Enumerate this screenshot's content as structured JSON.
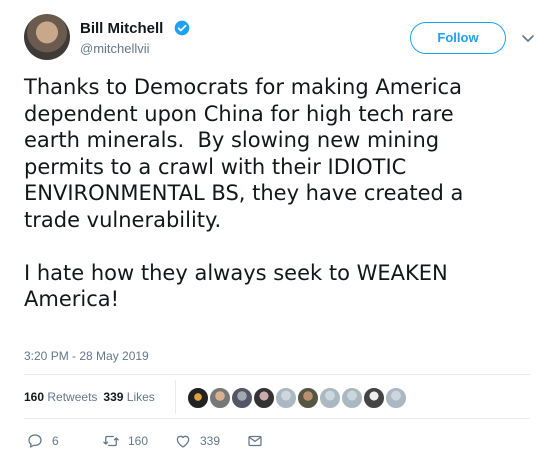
{
  "author": {
    "name": "Bill Mitchell",
    "handle": "@mitchellvii",
    "verified": true
  },
  "follow_label": "Follow",
  "tweet": {
    "text": "Thanks to Democrats for making America\ndependent upon China for high tech rare\nearth minerals.  By slowing new mining\npermits to a crawl with their IDIOTIC\nENVIRONMENTAL BS, they have created a\ntrade vulnerability.\n\nI hate how they always seek to WEAKEN\nAmerica!",
    "timestamp": "3:20 PM - 28 May 2019"
  },
  "stats": {
    "retweets_count": "160",
    "retweets_label": "Retweets",
    "likes_count": "339",
    "likes_label": "Likes"
  },
  "actions": {
    "replies": "6",
    "retweets": "160",
    "likes": "339"
  },
  "colors": {
    "accent": "#1da1f2",
    "secondary_text": "#657786",
    "primary_text": "#14171a",
    "divider": "#e6ecf0"
  },
  "icons": [
    "verified-badge-icon",
    "chevron-down-icon",
    "reply-icon",
    "retweet-icon",
    "like-icon",
    "direct-message-icon"
  ]
}
